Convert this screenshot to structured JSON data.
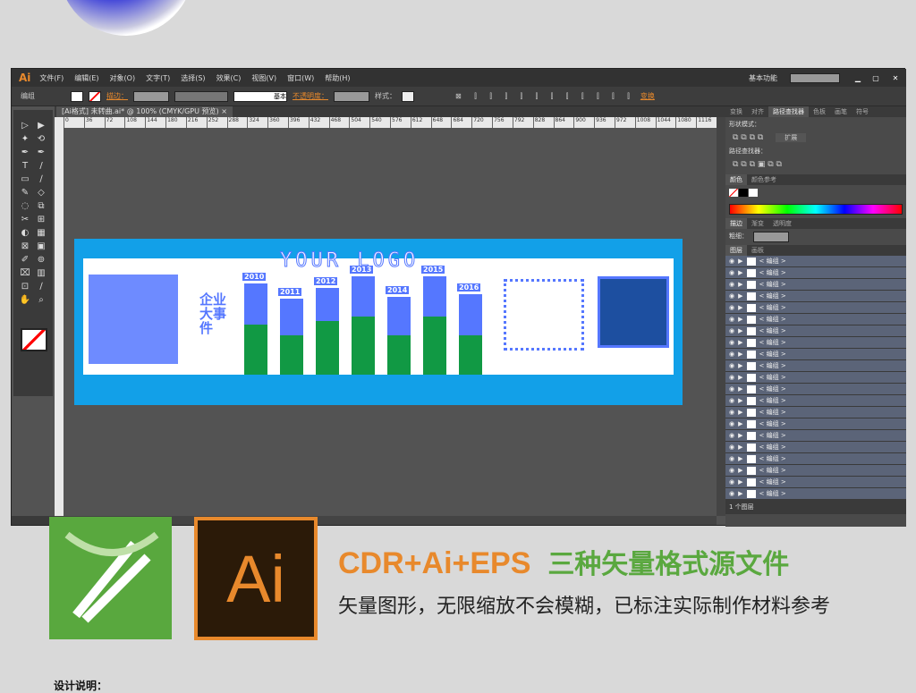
{
  "window": {
    "app_logo": "Ai",
    "menus": [
      "文件(F)",
      "编辑(E)",
      "对象(O)",
      "文字(T)",
      "选择(S)",
      "效果(C)",
      "视图(V)",
      "窗口(W)",
      "帮助(H)"
    ],
    "workspace": "基本功能",
    "search_placeholder": "",
    "controls": {
      "minimize": "▁",
      "maximize": "▢",
      "close": "✕"
    }
  },
  "control_bar": {
    "selection": "编组",
    "stroke_label": "描边：",
    "brush": "基本",
    "opacity_label": "不透明度：",
    "style_label": "样式：",
    "transform_label": "变换"
  },
  "document_tab": {
    "title": "[Ai格式] 未转曲.ai* @ 100% (CMYK/GPU 预览)",
    "close": "×"
  },
  "ruler_ticks": [
    "0",
    "36",
    "72",
    "108",
    "144",
    "180",
    "216",
    "252",
    "288",
    "324",
    "360",
    "396",
    "432",
    "468",
    "504",
    "540",
    "576",
    "612",
    "648",
    "684",
    "720",
    "756",
    "792",
    "828",
    "864",
    "900",
    "936",
    "972",
    "1008",
    "1044",
    "1080",
    "1116"
  ],
  "tools": [
    "▷",
    "▶",
    "✦",
    "⟲",
    "✒",
    "✒",
    "T",
    "/",
    "▭",
    "∕",
    "✎",
    "◇",
    "◌",
    "⧉",
    "✂",
    "⊞",
    "◐",
    "▦",
    "⊠",
    "▣",
    "✐",
    "⊚",
    "⌧",
    "▥",
    "⊡",
    "∕",
    "✋",
    "⌕"
  ],
  "panels": {
    "pathfinder_tabs": [
      "变换",
      "对齐",
      "路径查找器",
      "色板",
      "画笔",
      "符号"
    ],
    "shape_modes": "形状模式：",
    "expand": "扩展",
    "pathfinders": "路径查找器：",
    "color_tabs": [
      "颜色",
      "颜色参考"
    ],
    "stroke_tabs": [
      "描边",
      "渐变",
      "透明度"
    ],
    "weight_label": "粗细：",
    "layer_tabs": [
      "图层",
      "画板"
    ],
    "layer_item": "< 编组 >",
    "layer_count": "1 个图层"
  },
  "artwork": {
    "logo_text": "YOUR LOGO",
    "side_title": "企业大事件",
    "bars": [
      {
        "label": "2010",
        "total": 0.82,
        "green": 0.45
      },
      {
        "label": "2011",
        "total": 0.68,
        "green": 0.35
      },
      {
        "label": "2012",
        "total": 0.78,
        "green": 0.48
      },
      {
        "label": "2013",
        "total": 0.88,
        "green": 0.52
      },
      {
        "label": "2014",
        "total": 0.7,
        "green": 0.35
      },
      {
        "label": "2015",
        "total": 0.88,
        "green": 0.52
      },
      {
        "label": "2016",
        "total": 0.72,
        "green": 0.35
      }
    ],
    "colors": {
      "banner": "#12a0e8",
      "bar": "#5577ff",
      "bar_fill": "#119944"
    }
  },
  "promo": {
    "cdr_logo": "CorelDRAW",
    "ai_logo": "Ai",
    "headline_a": "CDR+Ai+EPS",
    "headline_b": "三种矢量格式源文件",
    "subtitle": "矢量图形，无限缩放不会模糊，已标注实际制作材料参考",
    "description_label": "设计说明：",
    "colors": {
      "orange": "#e8892c",
      "green": "#5aa83f"
    }
  }
}
